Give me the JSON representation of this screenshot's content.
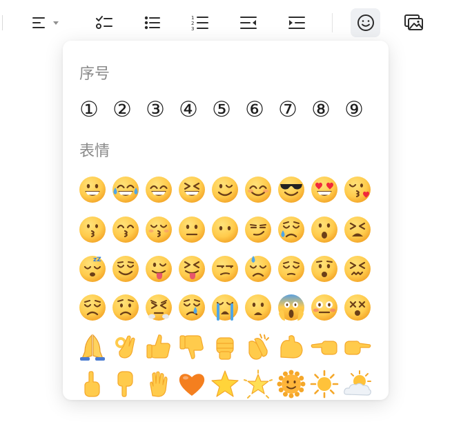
{
  "toolbar": {
    "buttons": [
      {
        "name": "align-icon"
      },
      {
        "name": "checklist-icon"
      },
      {
        "name": "bulleted-list-icon"
      },
      {
        "name": "numbered-list-icon"
      },
      {
        "name": "outdent-icon"
      },
      {
        "name": "indent-icon"
      },
      {
        "name": "emoji-icon",
        "active": true
      },
      {
        "name": "image-icon"
      }
    ]
  },
  "emoji_panel": {
    "numbers_title": "序号",
    "numbers": [
      "①",
      "②",
      "③",
      "④",
      "⑤",
      "⑥",
      "⑦",
      "⑧",
      "⑨"
    ],
    "emoji_title": "表情",
    "emoji_rows": [
      [
        "grinning-face-icon",
        "face-with-tears-of-joy-icon",
        "grinning-face-with-smiling-eyes-icon",
        "grinning-squinting-face-icon",
        "winking-face-icon",
        "smiling-face-with-smiling-eyes-icon",
        "smiling-face-with-sunglasses-icon",
        "smiling-face-with-heart-eyes-icon",
        "face-blowing-a-kiss-icon"
      ],
      [
        "kissing-face-icon",
        "kissing-face-with-smiling-eyes-icon",
        "kissing-face-with-closed-eyes-icon",
        "neutral-face-icon",
        "face-without-mouth-icon",
        "smirking-face-icon",
        "sad-but-relieved-face-icon",
        "face-with-open-mouth-icon",
        "tired-face-icon"
      ],
      [
        "sleeping-face-icon",
        "relieved-face-icon",
        "winking-face-with-tongue-icon",
        "squinting-face-with-tongue-icon",
        "unamused-face-icon",
        "downcast-face-with-sweat-icon",
        "pensive-face-icon",
        "hushed-face-icon",
        "confounded-face-icon"
      ],
      [
        "disappointed-face-icon",
        "worried-face-icon",
        "face-with-steam-from-nose-icon",
        "crying-face-icon",
        "loudly-crying-face-icon",
        "frowning-face-with-open-mouth-icon",
        "face-screaming-in-fear-icon",
        "flushed-face-icon",
        "dizzy-face-icon"
      ],
      [
        "folded-hands-icon",
        "ok-hand-icon",
        "thumbs-up-icon",
        "thumbs-down-icon",
        "raised-fist-icon",
        "clapping-hands-icon",
        "flexed-biceps-icon",
        "backhand-index-pointing-left-icon",
        "backhand-index-pointing-right-icon"
      ],
      [
        "backhand-index-pointing-up-icon",
        "backhand-index-pointing-down-icon",
        "raised-hand-icon",
        "orange-heart-icon",
        "star-icon",
        "glowing-star-icon",
        "sun-with-face-icon",
        "sun-icon",
        "sun-behind-cloud-icon"
      ]
    ]
  },
  "colors": {
    "emoji_yellow": "#ffcb4c",
    "emoji_shade": "#f4a72a",
    "feature_brown": "#6b3f18",
    "tear_blue": "#4fa6e8",
    "heart_red": "#f0293c",
    "heart_orange": "#f47f1f",
    "text_gray": "#8a8a8a",
    "text_dark": "#1e1e1e"
  }
}
